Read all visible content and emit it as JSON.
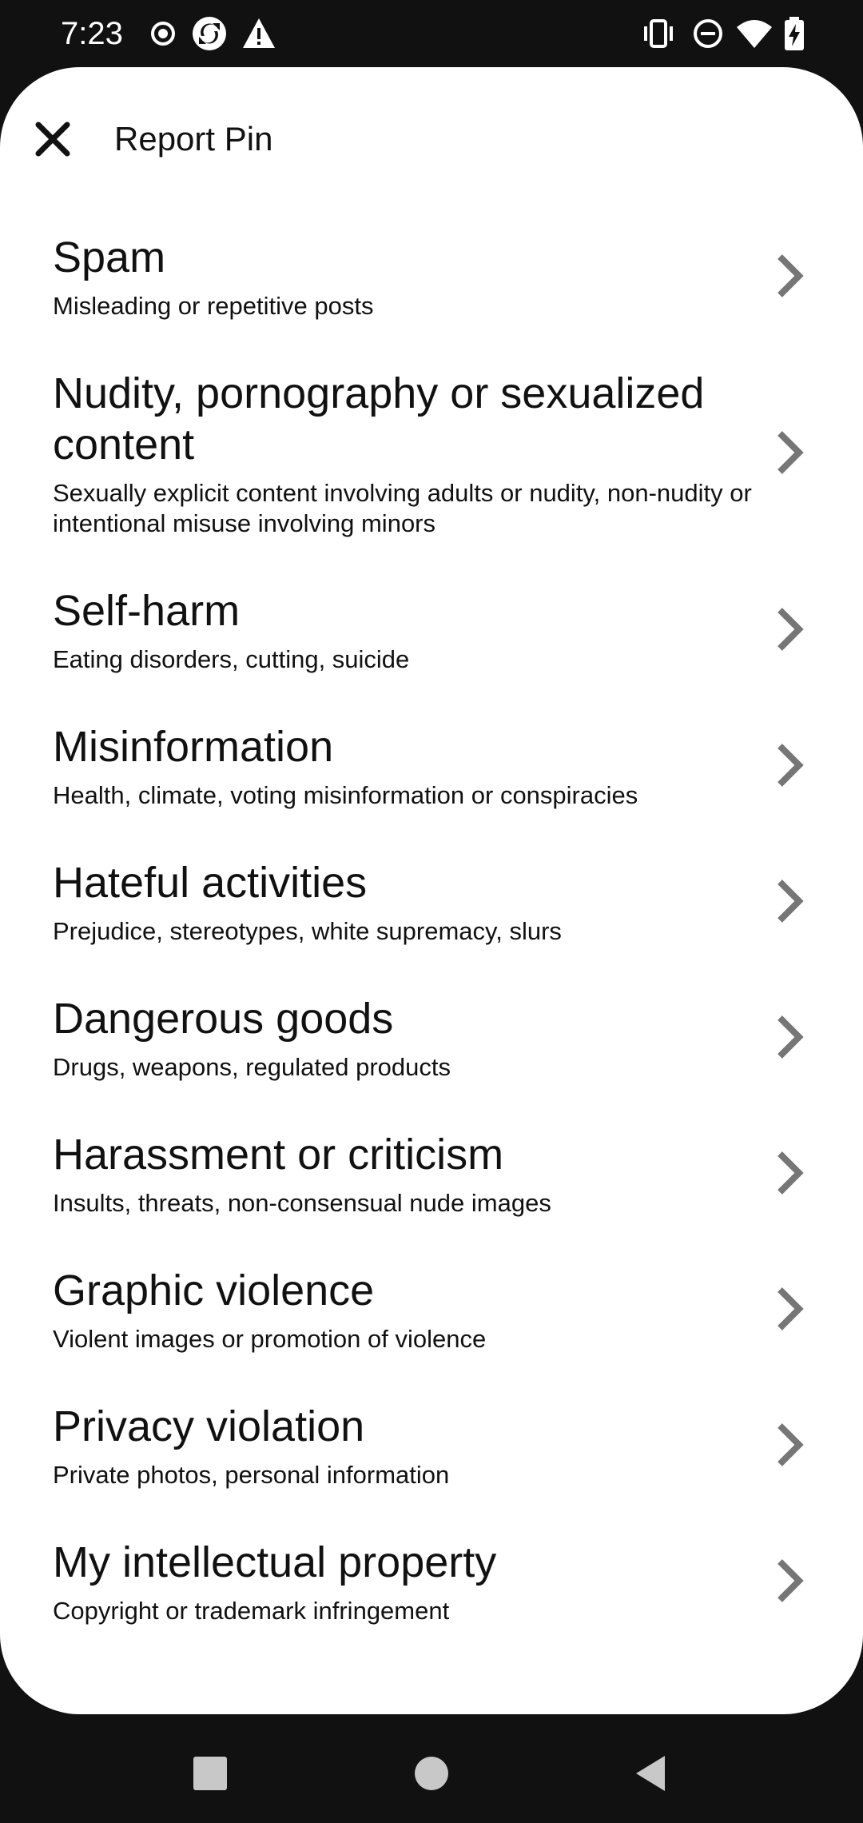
{
  "status_bar": {
    "time": "7:23",
    "left_icons": [
      "record-icon",
      "sync-icon",
      "warning-icon"
    ],
    "right_icons": [
      "vibrate-icon",
      "do-not-disturb-icon",
      "wifi-icon",
      "battery-charging-icon"
    ]
  },
  "header": {
    "close_icon": "close-icon",
    "title": "Report Pin"
  },
  "reasons": [
    {
      "title": "Spam",
      "description": "Misleading or repetitive posts"
    },
    {
      "title": "Nudity, pornography or sexualized content",
      "description": "Sexually explicit content involving adults or nudity, non-nudity or intentional misuse involving minors"
    },
    {
      "title": "Self-harm",
      "description": "Eating disorders, cutting, suicide"
    },
    {
      "title": "Misinformation",
      "description": "Health, climate, voting misinformation or conspiracies"
    },
    {
      "title": "Hateful activities",
      "description": "Prejudice, stereotypes, white supremacy, slurs"
    },
    {
      "title": "Dangerous goods",
      "description": "Drugs, weapons, regulated products"
    },
    {
      "title": "Harassment or criticism",
      "description": "Insults, threats, non-consensual nude images"
    },
    {
      "title": "Graphic violence",
      "description": "Violent images or promotion of violence"
    },
    {
      "title": "Privacy violation",
      "description": "Private photos, personal information"
    },
    {
      "title": "My intellectual property",
      "description": "Copyright or trademark infringement"
    }
  ],
  "nav_bar": {
    "buttons": [
      "recents-square-icon",
      "home-circle-icon",
      "back-triangle-icon"
    ]
  },
  "colors": {
    "system_bar": "#111111",
    "sheet": "#ffffff",
    "text": "#111111",
    "chevron": "#767676"
  }
}
